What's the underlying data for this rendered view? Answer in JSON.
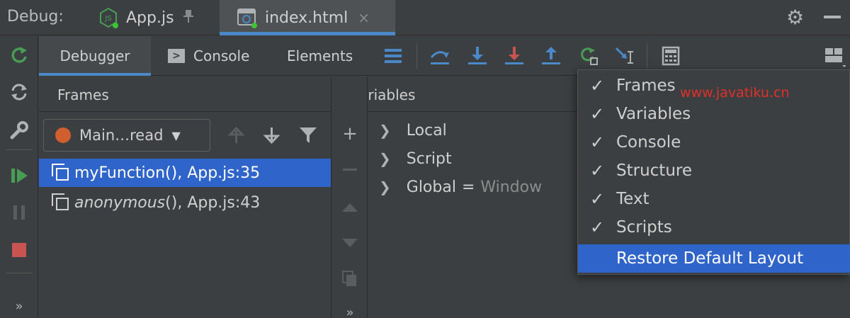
{
  "header": {
    "debug_label": "Debug:",
    "tabs": [
      {
        "label": "App.js"
      },
      {
        "label": "index.html",
        "close": "×"
      }
    ]
  },
  "debugger_tabs": {
    "debugger": "Debugger",
    "console": "Console",
    "elements": "Elements"
  },
  "frames": {
    "title": "Frames",
    "thread": "Main…read",
    "items": [
      {
        "name": "myFunction()",
        "location": ", App.js:35"
      },
      {
        "name": "anonymous",
        "suffix": "()",
        "location": ", App.js:43"
      }
    ]
  },
  "variables": {
    "title": "Variables",
    "items": [
      {
        "label": "Local"
      },
      {
        "label": "Script"
      },
      {
        "label": "Global",
        "eq": "=",
        "value": "Window"
      }
    ]
  },
  "menu": {
    "items": [
      {
        "label": "Frames",
        "check": "✓"
      },
      {
        "label": "Variables",
        "check": "✓"
      },
      {
        "label": "Console",
        "check": "✓"
      },
      {
        "label": "Structure",
        "check": "✓"
      },
      {
        "label": "Text",
        "check": "✓"
      },
      {
        "label": "Scripts",
        "check": "✓"
      }
    ],
    "restore": "Restore Default Layout"
  },
  "watermark": "www.javatiku.cn",
  "more_glyph": "»",
  "colors": {
    "accent": "#4a88c7",
    "selection": "#2f65ca",
    "resume_green": "#499c54",
    "stop_red": "#c75450",
    "thread_dot": "#d15e2e"
  }
}
